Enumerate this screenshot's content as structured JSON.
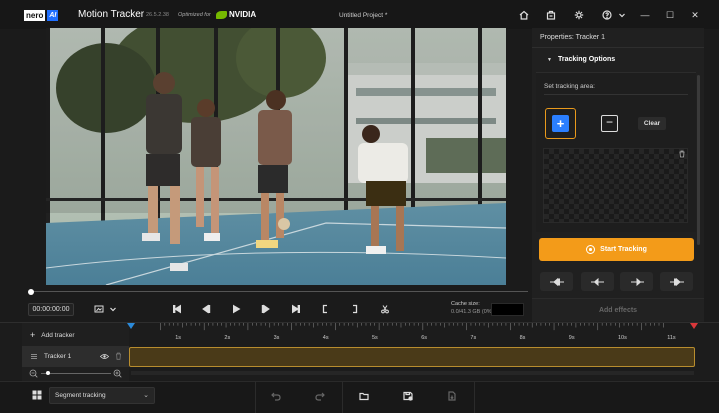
{
  "titlebar": {
    "logo_nero": "nero",
    "logo_ai": "AI",
    "app_title": "Motion Tracker",
    "version": "26.5.2.38",
    "optimized_for": "Optimized for",
    "nvidia": "NVIDIA",
    "project_title": "Untitled Project *",
    "icons": [
      "home-icon",
      "store-icon",
      "gear-icon",
      "help-icon",
      "chevron-down-icon"
    ],
    "window_controls": [
      "—",
      "☐",
      "✕"
    ]
  },
  "player": {
    "timecode": "00:00:00:00",
    "cache_label": "Cache size:",
    "cache_value": "0.0/41.3 GB (0%)",
    "progress": 0
  },
  "panel": {
    "header": "Properties: Tracker 1",
    "section_title": "Tracking Options",
    "set_area_label": "Set tracking area:",
    "clear_label": "Clear",
    "start_tracking": "Start Tracking",
    "add_effects": "Add effects"
  },
  "timeline": {
    "add_tracker": "Add tracker",
    "ticks": [
      "1s",
      "2s",
      "3s",
      "4s",
      "5s",
      "6s",
      "7s",
      "8s",
      "9s",
      "10s",
      "11s"
    ],
    "track_name": "Tracker 1"
  },
  "bottombar": {
    "mode": "Segment tracking"
  },
  "colors": {
    "accent_orange": "#f39b19",
    "accent_blue": "#2b7fff",
    "track_fill": "#4a3a18",
    "nvidia_green": "#76b900"
  }
}
